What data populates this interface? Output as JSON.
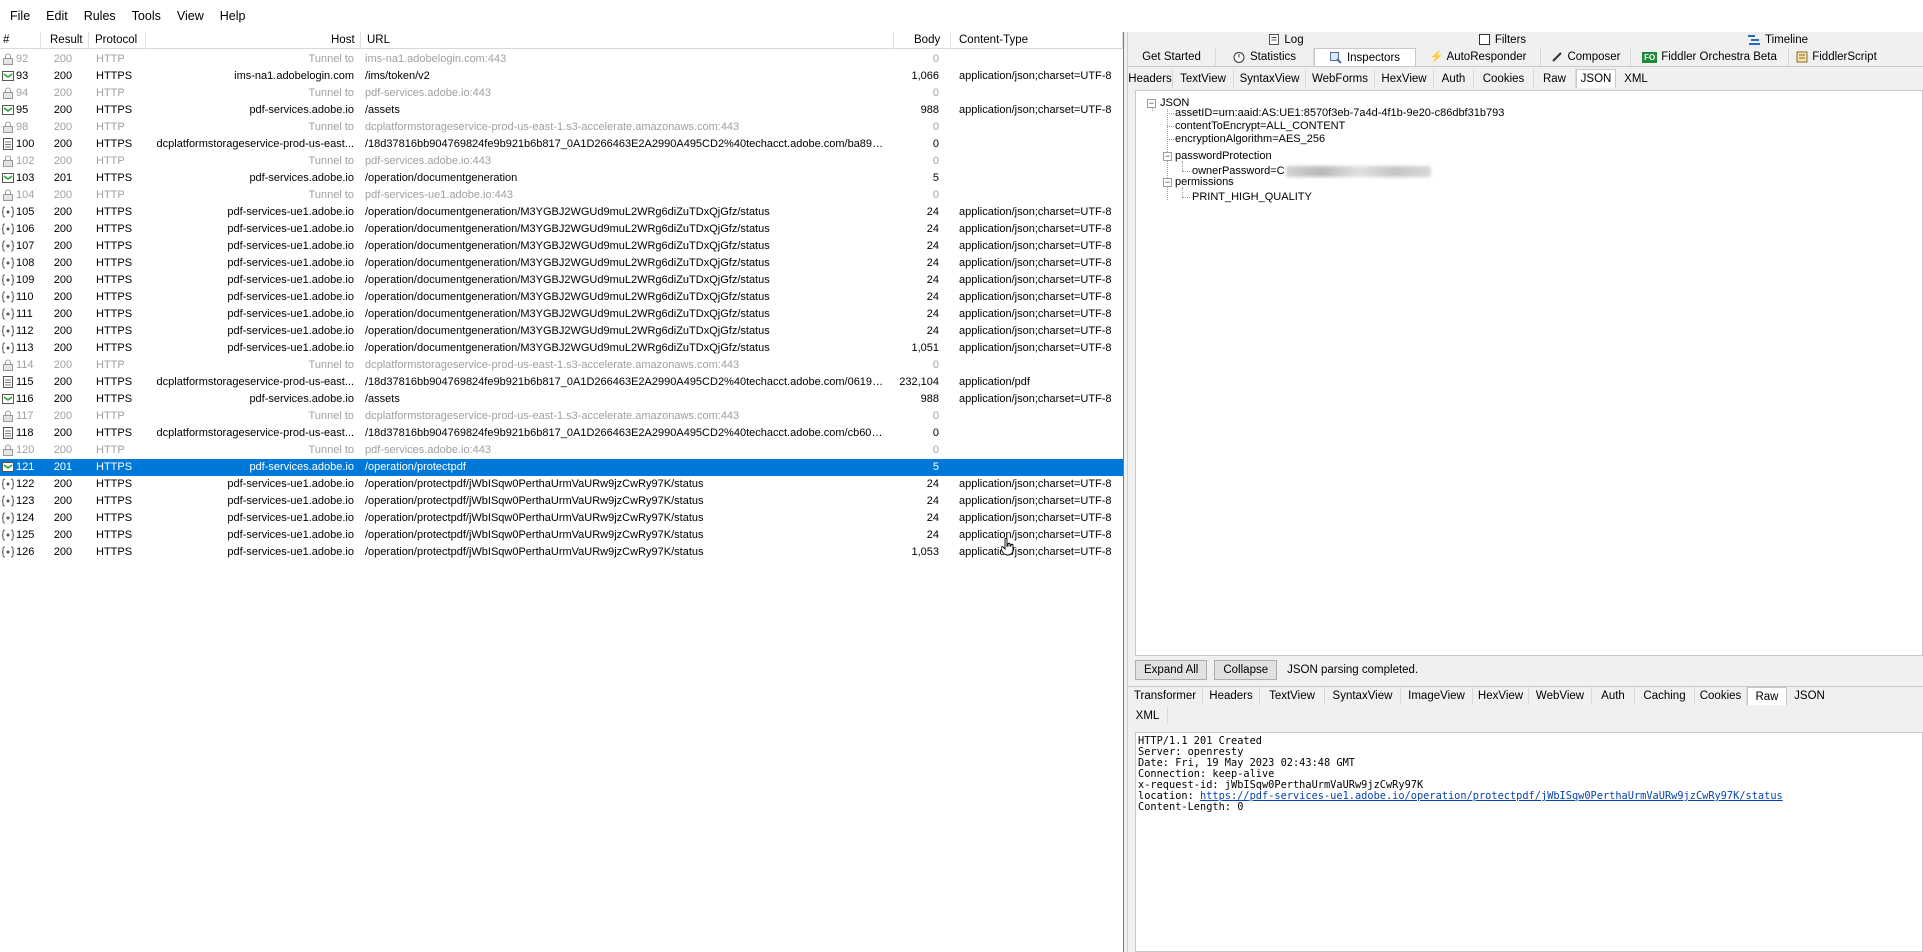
{
  "menu": [
    "File",
    "Edit",
    "Rules",
    "Tools",
    "View",
    "Help"
  ],
  "columns": {
    "num": "#",
    "result": "Result",
    "protocol": "Protocol",
    "host": "Host",
    "url": "URL",
    "body": "Body",
    "content_type": "Content-Type"
  },
  "sessions": [
    {
      "num": "92",
      "result": "200",
      "protocol": "HTTP",
      "host": "Tunnel to",
      "url": "ims-na1.adobelogin.com:443",
      "body": "0",
      "content_type": "",
      "tunnel": true,
      "icon": "lock-icon"
    },
    {
      "num": "93",
      "result": "200",
      "protocol": "HTTPS",
      "host": "ims-na1.adobelogin.com",
      "url": "/ims/token/v2",
      "body": "1,066",
      "content_type": "application/json;charset=UTF-8",
      "tunnel": false,
      "icon": "json-icon"
    },
    {
      "num": "94",
      "result": "200",
      "protocol": "HTTP",
      "host": "Tunnel to",
      "url": "pdf-services.adobe.io:443",
      "body": "0",
      "content_type": "",
      "tunnel": true,
      "icon": "lock-icon"
    },
    {
      "num": "95",
      "result": "200",
      "protocol": "HTTPS",
      "host": "pdf-services.adobe.io",
      "url": "/assets",
      "body": "988",
      "content_type": "application/json;charset=UTF-8",
      "tunnel": false,
      "icon": "json-icon"
    },
    {
      "num": "98",
      "result": "200",
      "protocol": "HTTP",
      "host": "Tunnel to",
      "url": "dcplatformstorageservice-prod-us-east-1.s3-accelerate.amazonaws.com:443",
      "body": "0",
      "content_type": "",
      "tunnel": true,
      "icon": "lock-icon"
    },
    {
      "num": "100",
      "result": "200",
      "protocol": "HTTPS",
      "host": "dcplatformstorageservice-prod-us-east...",
      "url": "/18d37816bb904769824fe9b921b6b817_0A1D266463E2A2990A495CD2%40techacct.adobe.com/ba89c...",
      "body": "0",
      "content_type": "",
      "tunnel": false,
      "icon": "doc-icon"
    },
    {
      "num": "102",
      "result": "200",
      "protocol": "HTTP",
      "host": "Tunnel to",
      "url": "pdf-services.adobe.io:443",
      "body": "0",
      "content_type": "",
      "tunnel": true,
      "icon": "lock-icon"
    },
    {
      "num": "103",
      "result": "201",
      "protocol": "HTTPS",
      "host": "pdf-services.adobe.io",
      "url": "/operation/documentgeneration",
      "body": "5",
      "content_type": "",
      "tunnel": false,
      "icon": "json-icon"
    },
    {
      "num": "104",
      "result": "200",
      "protocol": "HTTP",
      "host": "Tunnel to",
      "url": "pdf-services-ue1.adobe.io:443",
      "body": "0",
      "content_type": "",
      "tunnel": true,
      "icon": "lock-icon"
    },
    {
      "num": "105",
      "result": "200",
      "protocol": "HTTPS",
      "host": "pdf-services-ue1.adobe.io",
      "url": "/operation/documentgeneration/M3YGBJ2WGUd9muL2WRg6diZuTDxQjGfz/status",
      "body": "24",
      "content_type": "application/json;charset=UTF-8",
      "tunnel": false,
      "icon": "js-icon"
    },
    {
      "num": "106",
      "result": "200",
      "protocol": "HTTPS",
      "host": "pdf-services-ue1.adobe.io",
      "url": "/operation/documentgeneration/M3YGBJ2WGUd9muL2WRg6diZuTDxQjGfz/status",
      "body": "24",
      "content_type": "application/json;charset=UTF-8",
      "tunnel": false,
      "icon": "js-icon"
    },
    {
      "num": "107",
      "result": "200",
      "protocol": "HTTPS",
      "host": "pdf-services-ue1.adobe.io",
      "url": "/operation/documentgeneration/M3YGBJ2WGUd9muL2WRg6diZuTDxQjGfz/status",
      "body": "24",
      "content_type": "application/json;charset=UTF-8",
      "tunnel": false,
      "icon": "js-icon"
    },
    {
      "num": "108",
      "result": "200",
      "protocol": "HTTPS",
      "host": "pdf-services-ue1.adobe.io",
      "url": "/operation/documentgeneration/M3YGBJ2WGUd9muL2WRg6diZuTDxQjGfz/status",
      "body": "24",
      "content_type": "application/json;charset=UTF-8",
      "tunnel": false,
      "icon": "js-icon"
    },
    {
      "num": "109",
      "result": "200",
      "protocol": "HTTPS",
      "host": "pdf-services-ue1.adobe.io",
      "url": "/operation/documentgeneration/M3YGBJ2WGUd9muL2WRg6diZuTDxQjGfz/status",
      "body": "24",
      "content_type": "application/json;charset=UTF-8",
      "tunnel": false,
      "icon": "js-icon"
    },
    {
      "num": "110",
      "result": "200",
      "protocol": "HTTPS",
      "host": "pdf-services-ue1.adobe.io",
      "url": "/operation/documentgeneration/M3YGBJ2WGUd9muL2WRg6diZuTDxQjGfz/status",
      "body": "24",
      "content_type": "application/json;charset=UTF-8",
      "tunnel": false,
      "icon": "js-icon"
    },
    {
      "num": "111",
      "result": "200",
      "protocol": "HTTPS",
      "host": "pdf-services-ue1.adobe.io",
      "url": "/operation/documentgeneration/M3YGBJ2WGUd9muL2WRg6diZuTDxQjGfz/status",
      "body": "24",
      "content_type": "application/json;charset=UTF-8",
      "tunnel": false,
      "icon": "js-icon"
    },
    {
      "num": "112",
      "result": "200",
      "protocol": "HTTPS",
      "host": "pdf-services-ue1.adobe.io",
      "url": "/operation/documentgeneration/M3YGBJ2WGUd9muL2WRg6diZuTDxQjGfz/status",
      "body": "24",
      "content_type": "application/json;charset=UTF-8",
      "tunnel": false,
      "icon": "js-icon"
    },
    {
      "num": "113",
      "result": "200",
      "protocol": "HTTPS",
      "host": "pdf-services-ue1.adobe.io",
      "url": "/operation/documentgeneration/M3YGBJ2WGUd9muL2WRg6diZuTDxQjGfz/status",
      "body": "1,051",
      "content_type": "application/json;charset=UTF-8",
      "tunnel": false,
      "icon": "js-icon"
    },
    {
      "num": "114",
      "result": "200",
      "protocol": "HTTP",
      "host": "Tunnel to",
      "url": "dcplatformstorageservice-prod-us-east-1.s3-accelerate.amazonaws.com:443",
      "body": "0",
      "content_type": "",
      "tunnel": true,
      "icon": "lock-icon"
    },
    {
      "num": "115",
      "result": "200",
      "protocol": "HTTPS",
      "host": "dcplatformstorageservice-prod-us-east...",
      "url": "/18d37816bb904769824fe9b921b6b817_0A1D266463E2A2990A495CD2%40techacct.adobe.com/06190...",
      "body": "232,104",
      "content_type": "application/pdf",
      "tunnel": false,
      "icon": "doc-icon"
    },
    {
      "num": "116",
      "result": "200",
      "protocol": "HTTPS",
      "host": "pdf-services.adobe.io",
      "url": "/assets",
      "body": "988",
      "content_type": "application/json;charset=UTF-8",
      "tunnel": false,
      "icon": "json-icon"
    },
    {
      "num": "117",
      "result": "200",
      "protocol": "HTTP",
      "host": "Tunnel to",
      "url": "dcplatformstorageservice-prod-us-east-1.s3-accelerate.amazonaws.com:443",
      "body": "0",
      "content_type": "",
      "tunnel": true,
      "icon": "lock-icon"
    },
    {
      "num": "118",
      "result": "200",
      "protocol": "HTTPS",
      "host": "dcplatformstorageservice-prod-us-east...",
      "url": "/18d37816bb904769824fe9b921b6b817_0A1D266463E2A2990A495CD2%40techacct.adobe.com/cb60a...",
      "body": "0",
      "content_type": "",
      "tunnel": false,
      "icon": "doc-icon"
    },
    {
      "num": "120",
      "result": "200",
      "protocol": "HTTP",
      "host": "Tunnel to",
      "url": "pdf-services.adobe.io:443",
      "body": "0",
      "content_type": "",
      "tunnel": true,
      "icon": "lock-icon"
    },
    {
      "num": "121",
      "result": "201",
      "protocol": "HTTPS",
      "host": "pdf-services.adobe.io",
      "url": "/operation/protectpdf",
      "body": "5",
      "content_type": "",
      "tunnel": false,
      "icon": "json-icon",
      "selected": true
    },
    {
      "num": "122",
      "result": "200",
      "protocol": "HTTPS",
      "host": "pdf-services-ue1.adobe.io",
      "url": "/operation/protectpdf/jWbISqw0PerthaUrmVaURw9jzCwRy97K/status",
      "body": "24",
      "content_type": "application/json;charset=UTF-8",
      "tunnel": false,
      "icon": "js-icon"
    },
    {
      "num": "123",
      "result": "200",
      "protocol": "HTTPS",
      "host": "pdf-services-ue1.adobe.io",
      "url": "/operation/protectpdf/jWbISqw0PerthaUrmVaURw9jzCwRy97K/status",
      "body": "24",
      "content_type": "application/json;charset=UTF-8",
      "tunnel": false,
      "icon": "js-icon"
    },
    {
      "num": "124",
      "result": "200",
      "protocol": "HTTPS",
      "host": "pdf-services-ue1.adobe.io",
      "url": "/operation/protectpdf/jWbISqw0PerthaUrmVaURw9jzCwRy97K/status",
      "body": "24",
      "content_type": "application/json;charset=UTF-8",
      "tunnel": false,
      "icon": "js-icon"
    },
    {
      "num": "125",
      "result": "200",
      "protocol": "HTTPS",
      "host": "pdf-services-ue1.adobe.io",
      "url": "/operation/protectpdf/jWbISqw0PerthaUrmVaURw9jzCwRy97K/status",
      "body": "24",
      "content_type": "application/json;charset=UTF-8",
      "tunnel": false,
      "icon": "js-icon"
    },
    {
      "num": "126",
      "result": "200",
      "protocol": "HTTPS",
      "host": "pdf-services-ue1.adobe.io",
      "url": "/operation/protectpdf/jWbISqw0PerthaUrmVaURw9jzCwRy97K/status",
      "body": "1,053",
      "content_type": "application/json;charset=UTF-8",
      "tunnel": false,
      "icon": "js-icon"
    }
  ],
  "top_tabs": {
    "log": "Log",
    "filters": "Filters",
    "timeline": "Timeline"
  },
  "main_tabs": [
    "Get Started",
    "Statistics",
    "Inspectors",
    "AutoResponder",
    "Composer",
    "Fiddler Orchestra Beta",
    "FiddlerScript"
  ],
  "fo_badge": "FO",
  "request_tabs": [
    "Headers",
    "TextView",
    "SyntaxView",
    "WebForms",
    "HexView",
    "Auth",
    "Cookies",
    "Raw",
    "JSON",
    "XML"
  ],
  "json_tree": {
    "root": "JSON",
    "asset_id": "assetID=urn:aaid:AS:UE1:8570f3eb-7a4d-4f1b-9e20-c86dbf31b793",
    "content_to_encrypt": "contentToEncrypt=ALL_CONTENT",
    "encryption_algorithm": "encryptionAlgorithm=AES_256",
    "password_protection": "passwordProtection",
    "owner_password": "ownerPassword=C",
    "permissions": "permissions",
    "print_quality": "PRINT_HIGH_QUALITY"
  },
  "expand_bar": {
    "expand_all": "Expand All",
    "collapse": "Collapse",
    "status": "JSON parsing completed."
  },
  "response_tabs": [
    "Transformer",
    "Headers",
    "TextView",
    "SyntaxView",
    "ImageView",
    "HexView",
    "WebView",
    "Auth",
    "Caching",
    "Cookies",
    "Raw",
    "JSON"
  ],
  "response_tabs_row2": [
    "XML"
  ],
  "raw_response": {
    "status": "HTTP/1.1 201 Created",
    "server": "Server: openresty",
    "date": "Date: Fri, 19 May 2023 02:43:48 GMT",
    "connection": "Connection: keep-alive",
    "request_id": "x-request-id: jWbISqw0PerthaUrmVaURw9jzCwRy97K",
    "location_label": "location: ",
    "location_url": "https://pdf-services-ue1.adobe.io/operation/protectpdf/jWbISqw0PerthaUrmVaURw9jzCwRy97K/status",
    "content_length": "Content-Length: 0"
  },
  "colors": {
    "selection": "#0078d7",
    "tunnel_text": "#a0a0a0",
    "link": "#0645ad",
    "panel_bg": "#f0f0f0"
  }
}
